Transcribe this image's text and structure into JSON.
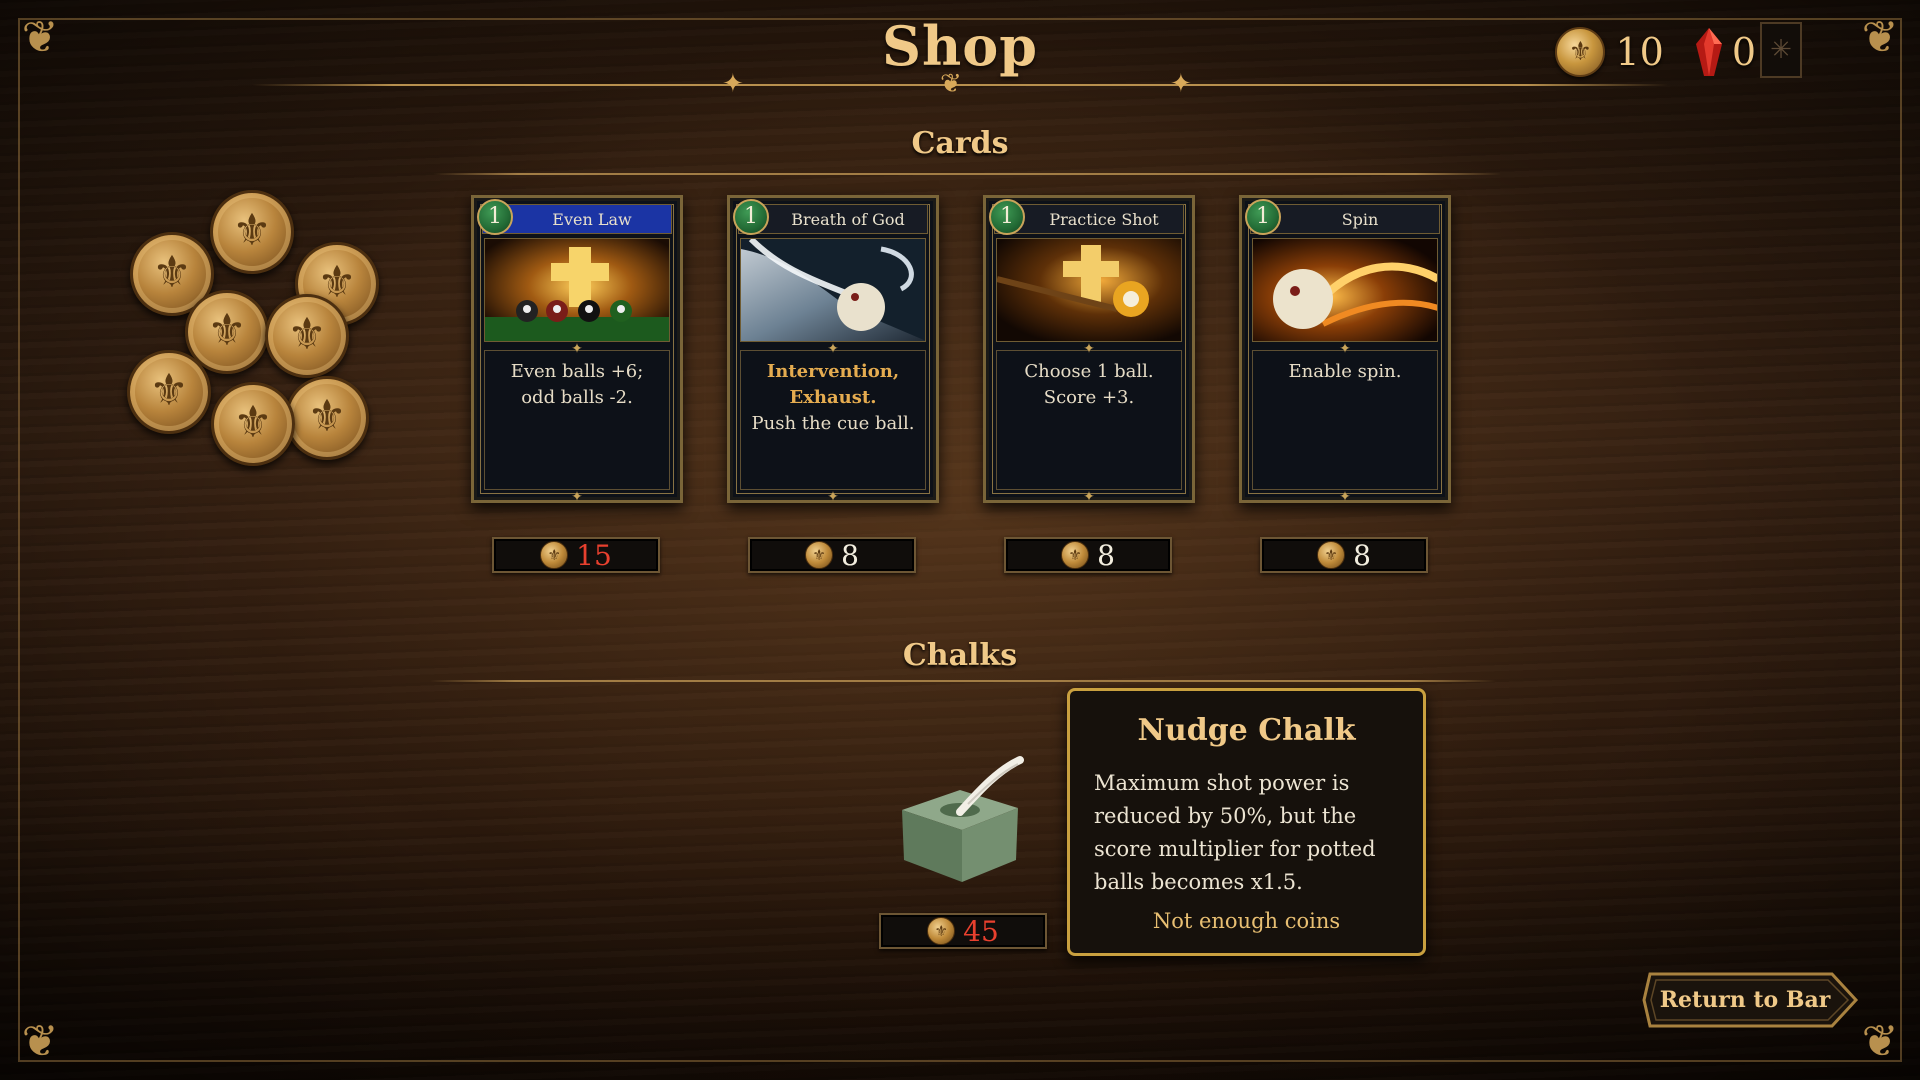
{
  "header": {
    "title": "Shop"
  },
  "currency": {
    "coins": "10",
    "gems": "0",
    "coin_icon": "fleur-de-lis-coin-icon",
    "gem_icon": "red-crystal-icon",
    "gem_color": "#d6261e"
  },
  "settings": {
    "icon": "settings-icon"
  },
  "sections": {
    "cards": "Cards",
    "chalks": "Chalks"
  },
  "cards": [
    {
      "cost": "1",
      "name": "Even Law",
      "highlighted": true,
      "keywords": "",
      "description": "Even balls +6; odd balls -2.",
      "price": "15",
      "affordable": false
    },
    {
      "cost": "1",
      "name": "Breath of God",
      "highlighted": false,
      "keywords": "Intervention, Exhaust.",
      "description": "Push the cue ball.",
      "price": "8",
      "affordable": true
    },
    {
      "cost": "1",
      "name": "Practice Shot",
      "highlighted": false,
      "keywords": "",
      "description": "Choose 1 ball. Score +3.",
      "price": "8",
      "affordable": true
    },
    {
      "cost": "1",
      "name": "Spin",
      "highlighted": false,
      "keywords": "",
      "description": "Enable spin.",
      "price": "8",
      "affordable": true
    }
  ],
  "chalk": {
    "price": "45",
    "affordable": false
  },
  "tooltip": {
    "title": "Nudge Chalk",
    "body": "Maximum shot power is reduced by 50%, but the score multiplier for potted balls becomes x1.5.",
    "warning": "Not enough coins"
  },
  "buttons": {
    "return": "Return to Bar"
  },
  "colors": {
    "gold": "#f0c988",
    "unaffordable_price": "#e8402e",
    "highlight_header": "#1b34a4",
    "cost_badge": "#236b35"
  }
}
